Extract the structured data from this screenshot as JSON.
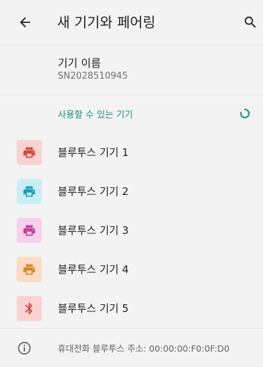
{
  "appbar": {
    "title": "새 기기와 페어링",
    "back_icon": "arrow-back-icon",
    "search_icon": "search-icon"
  },
  "device_name": {
    "label": "기기 이름",
    "value": "SN2028510945"
  },
  "available": {
    "header": "사용할 수 있는 기기",
    "accent_color": "#1a8f7e",
    "devices": [
      {
        "label": "블루투스 기기 1",
        "icon": "printer-icon",
        "bg": "#f9d3d1",
        "fg": "#d6453d"
      },
      {
        "label": "블루투스 기기 2",
        "icon": "printer-icon",
        "bg": "#c9eef5",
        "fg": "#1da1b5"
      },
      {
        "label": "블루투스 기기 3",
        "icon": "printer-icon",
        "bg": "#f9d0ec",
        "fg": "#c43c9c"
      },
      {
        "label": "블루투스 기기 4",
        "icon": "printer-icon",
        "bg": "#fddcc4",
        "fg": "#d68a2c"
      },
      {
        "label": "블루투스 기기 5",
        "icon": "bluetooth-icon",
        "bg": "#f9d3d1",
        "fg": "#d6453d"
      }
    ]
  },
  "footer": {
    "text": "휴대전화 블루투스 주소: 00:00:00:F0:0F:D0",
    "icon": "info-icon"
  }
}
